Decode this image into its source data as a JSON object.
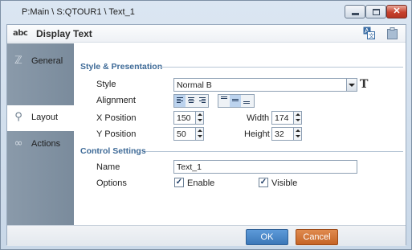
{
  "window": {
    "title": "P:Main \\ S:QTOUR1 \\ Text_1"
  },
  "header": {
    "icon_text": "abc",
    "title": "Display Text"
  },
  "sidebar": {
    "items": [
      {
        "label": "General",
        "icon": "wand-icon",
        "active": false
      },
      {
        "label": "Layout",
        "icon": "magnifier-icon",
        "active": true
      },
      {
        "label": "Actions",
        "icon": "link-icon",
        "active": false
      }
    ]
  },
  "style_presentation": {
    "section_title": "Style & Presentation",
    "style": {
      "label": "Style",
      "value": "Normal B"
    },
    "alignment": {
      "label": "Alignment"
    },
    "x_position": {
      "label": "X Position",
      "value": "150"
    },
    "y_position": {
      "label": "Y Position",
      "value": "50"
    },
    "width": {
      "label": "Width",
      "value": "174"
    },
    "height": {
      "label": "Height",
      "value": "32"
    }
  },
  "control_settings": {
    "section_title": "Control Settings",
    "name": {
      "label": "Name",
      "value": "Text_1"
    },
    "options": {
      "label": "Options",
      "enable": "Enable",
      "visible": "Visible"
    }
  },
  "footer": {
    "ok": "OK",
    "cancel": "Cancel"
  },
  "colors": {
    "ok": "#3b77b8",
    "cancel": "#c56426",
    "section": "#3e6a97",
    "sidebar": "#8a9aaa"
  }
}
